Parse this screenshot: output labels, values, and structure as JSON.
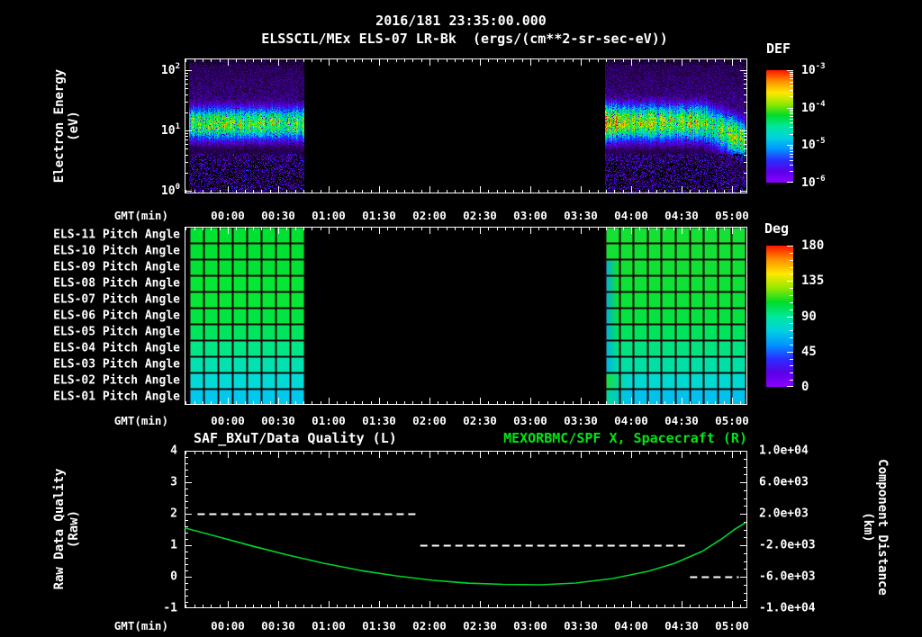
{
  "header": {
    "line1": "2016/181 23:35:00.000",
    "line2": "ELSSCIL/MEx ELS-07 LR-Bk  (ergs/(cm**2-sr-sec-eV))"
  },
  "time_axis": {
    "gmt_label": "GMT(min)",
    "labels": [
      "00:00",
      "00:30",
      "01:00",
      "01:30",
      "02:00",
      "02:30",
      "03:00",
      "03:30",
      "04:00",
      "04:30",
      "05:00"
    ],
    "label_minutes": [
      0,
      30,
      60,
      90,
      120,
      150,
      180,
      210,
      240,
      270,
      300
    ],
    "range_min": [
      -25.7,
      308.9
    ]
  },
  "top_panel": {
    "ylabel_line1": "Electron Energy",
    "ylabel_line2": "(eV)",
    "yticks": [
      {
        "mant": "10",
        "exp": "2",
        "log": 2
      },
      {
        "mant": "10",
        "exp": "1",
        "log": 1
      },
      {
        "mant": "10",
        "exp": "0",
        "log": 0
      }
    ],
    "colorbar": {
      "title": "DEF",
      "ticks": [
        {
          "mant": "10",
          "exp": "-3"
        },
        {
          "mant": "10",
          "exp": "-4"
        },
        {
          "mant": "10",
          "exp": "-5"
        },
        {
          "mant": "10",
          "exp": "-6"
        }
      ]
    }
  },
  "middle_panel": {
    "row_labels": [
      "ELS-11 Pitch Angle",
      "ELS-10 Pitch Angle",
      "ELS-09 Pitch Angle",
      "ELS-08 Pitch Angle",
      "ELS-07 Pitch Angle",
      "ELS-06 Pitch Angle",
      "ELS-05 Pitch Angle",
      "ELS-04 Pitch Angle",
      "ELS-03 Pitch Angle",
      "ELS-02 Pitch Angle",
      "ELS-01 Pitch Angle"
    ],
    "colorbar": {
      "title": "Deg",
      "ticks": [
        "180",
        "135",
        "90",
        "45",
        "0"
      ]
    }
  },
  "bottom_panel": {
    "title_left": "SAF_BXuT/Data Quality (L)",
    "title_right": "MEXORBMC/SPF X, Spacecraft (R)",
    "title_right_color": "#00e614",
    "ylabel_left_line1": "Raw Data Quality",
    "ylabel_left_line2": "(Raw)",
    "ylabel_right_line1": "Component Distance",
    "ylabel_right_line2": "(km)",
    "yticks_left": [
      "4",
      "3",
      "2",
      "1",
      "0",
      "-1"
    ],
    "yticks_right": [
      "1.0e+04",
      "6.0e+03",
      "2.0e+03",
      "-2.0e+03",
      "-6.0e+03",
      "-1.0e+04"
    ]
  },
  "colors": {
    "background": "#000000",
    "axis": "#ffffff",
    "curve_green": "#00d22c",
    "grid_line": "#190404"
  },
  "chart_data": [
    {
      "type": "heatmap",
      "title": "ELSSCIL/MEx ELS-07 LR-Bk (ergs/(cm**2-sr-sec-eV))",
      "xlabel": "GMT(min)",
      "ylabel": "Electron Energy (eV)",
      "y_scale": "log",
      "y_range_eV": [
        0.85,
        140
      ],
      "x_range_min": [
        -25.7,
        308.9
      ],
      "colorbar": {
        "title": "DEF",
        "units": "ergs/(cm**2-sr-sec-eV)",
        "min": "1e-6",
        "max": "1e-3",
        "scale": "log",
        "palette": "rainbow"
      },
      "segments": [
        {
          "t_start_min": -23,
          "t_end_min": 45.5,
          "band_center_log10eV": 1.12,
          "band_sigma_log": 0.21,
          "band_amp": 0.7,
          "haze_amp": 0.3,
          "note": "broad green flux band near 13 eV, blue haze above, purple speckle below 4 eV"
        },
        {
          "t_start_min": 224.5,
          "t_end_min": 308,
          "band_center_log10eV": 1.14,
          "band_sigma_log": 0.23,
          "band_amp": 0.74,
          "haze_amp": 0.3,
          "bright_until_min": 233,
          "drop_after_min": 283,
          "drop_log_per_min": 0.012,
          "note": "band brighter at start, drifts to lower energy after 04:45"
        }
      ],
      "gaps": [
        {
          "t_start_min": 45.5,
          "t_end_min": 224.5,
          "note": "no data"
        }
      ]
    },
    {
      "type": "heatmap",
      "rows": [
        "ELS-11",
        "ELS-10",
        "ELS-09",
        "ELS-08",
        "ELS-07",
        "ELS-06",
        "ELS-05",
        "ELS-04",
        "ELS-03",
        "ELS-02",
        "ELS-01"
      ],
      "units": "deg",
      "colorbar": {
        "title": "Deg",
        "min": 0,
        "max": 180,
        "palette": "rainbow"
      },
      "segments": [
        {
          "t_start_min": -23,
          "t_end_min": 45.5,
          "columns": 8,
          "pitch_deg_per_row": [
            112,
            112,
            111,
            110,
            109,
            106,
            102,
            96,
            89,
            81,
            73
          ],
          "row_colors": [
            "#00e232",
            "#00e232",
            "#01e334",
            "#04e734",
            "#08e736",
            "#00e542",
            "#00e55e",
            "#00e786",
            "#00e2b0",
            "#00dbd8",
            "#00c9ee"
          ]
        },
        {
          "t_start_min": 224.5,
          "t_end_min": 308,
          "columns": 10,
          "pitch_deg_per_row": [
            111,
            111,
            110,
            110,
            109,
            107,
            101,
            95,
            88,
            80,
            71
          ],
          "row_colors": [
            "#14e134",
            "#12e134",
            "#10e134",
            "#0ee236",
            "#0ce33a",
            "#06e242",
            "#00e35c",
            "#00e37e",
            "#00dfa6",
            "#00d8d2",
            "#00c2ec"
          ],
          "leading_edge_stripe": {
            "rows": [
              2,
              3,
              4,
              5,
              6,
              7,
              8
            ],
            "color": "#00aaee",
            "approx_deg": 66
          },
          "leading_edge_bottom_rows": [
            {
              "row": 9,
              "color": "#16df3c"
            },
            {
              "row": 10,
              "color": "#00d890"
            }
          ]
        }
      ]
    },
    {
      "type": "line",
      "x_range_min": [
        -25.7,
        308.9
      ],
      "y_left": {
        "label": "Raw Data Quality (Raw)",
        "range": [
          -1,
          4
        ]
      },
      "y_right": {
        "label": "Component Distance (km)",
        "range": [
          -10000,
          10000
        ]
      },
      "series": [
        {
          "name": "SAF_BXuT/Data Quality (L)",
          "axis": "left",
          "style": "dashed",
          "color": "#ffffff",
          "steps": [
            {
              "value": 2,
              "t_start_min": -18,
              "t_end_min": 112.5
            },
            {
              "value": 1,
              "t_start_min": 114.5,
              "t_end_min": 273
            },
            {
              "value": 0,
              "t_start_min": 275,
              "t_end_min": 304
            }
          ]
        },
        {
          "name": "MEXORBMC/SPF X, Spacecraft (R)",
          "axis": "right",
          "style": "solid",
          "color": "#00d22c",
          "points_t_km": [
            [
              -25.7,
              200
            ],
            [
              -7,
              -860
            ],
            [
              14.5,
              -2100
            ],
            [
              36,
              -3260
            ],
            [
              57,
              -4290
            ],
            [
              79,
              -5210
            ],
            [
              100,
              -5890
            ],
            [
              122,
              -6460
            ],
            [
              143,
              -6810
            ],
            [
              164,
              -6980
            ],
            [
              186,
              -7030
            ],
            [
              207,
              -6800
            ],
            [
              229,
              -6230
            ],
            [
              250,
              -5320
            ],
            [
              266,
              -4290
            ],
            [
              282,
              -2810
            ],
            [
              293,
              -1320
            ],
            [
              301,
              -60
            ],
            [
              308,
              860
            ]
          ]
        }
      ]
    }
  ]
}
